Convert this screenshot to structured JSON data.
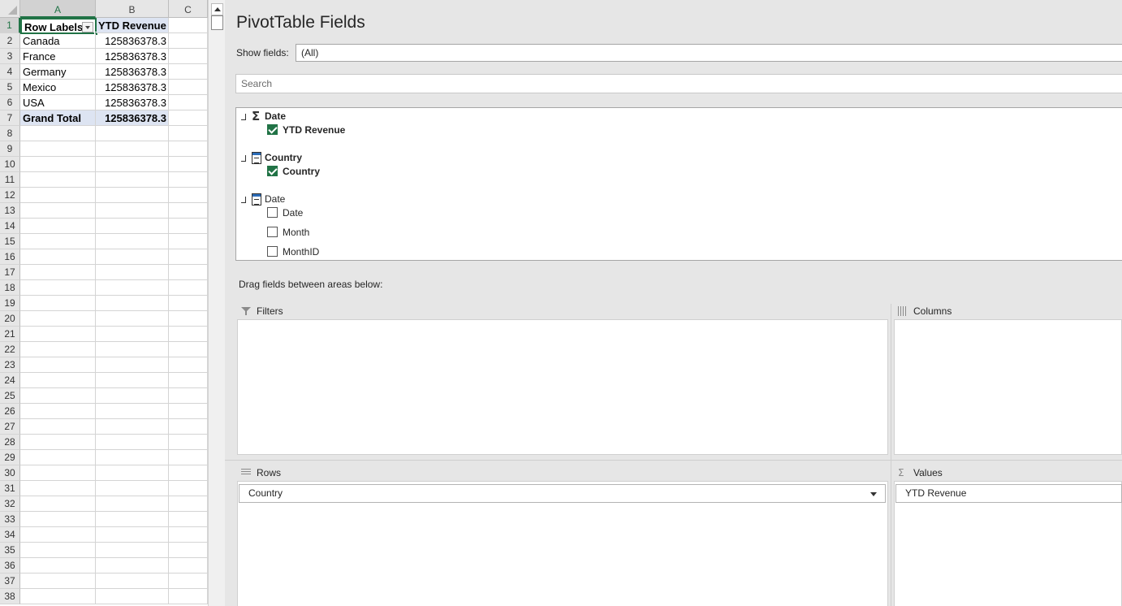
{
  "sheet": {
    "columns": [
      "A",
      "B",
      "C"
    ],
    "rows": [
      "1",
      "2",
      "3",
      "4",
      "5",
      "6",
      "7",
      "8",
      "9",
      "10",
      "11",
      "12",
      "13",
      "14",
      "15",
      "16",
      "17",
      "18",
      "19",
      "20",
      "21",
      "22",
      "23",
      "24",
      "25",
      "26",
      "27",
      "28",
      "29",
      "30",
      "31",
      "32",
      "33",
      "34",
      "35",
      "36",
      "37",
      "38"
    ],
    "pivot": {
      "header_a": "Row Labels",
      "header_b": "YTD Revenue",
      "items": [
        {
          "label": "Canada",
          "value": "125836378.3"
        },
        {
          "label": "France",
          "value": "125836378.3"
        },
        {
          "label": "Germany",
          "value": "125836378.3"
        },
        {
          "label": "Mexico",
          "value": "125836378.3"
        },
        {
          "label": "USA",
          "value": "125836378.3"
        }
      ],
      "total_label": "Grand Total",
      "total_value": "125836378.3"
    }
  },
  "pane": {
    "title": "PivotTable Fields",
    "show_fields_label": "Show fields:",
    "show_fields_value": "(All)",
    "search_placeholder": "Search",
    "tables": [
      {
        "name": "Date",
        "icon": "sigma-icon",
        "fields": [
          {
            "name": "YTD Revenue",
            "checked": true
          }
        ]
      },
      {
        "name": "Country",
        "icon": "table-icon",
        "fields": [
          {
            "name": "Country",
            "checked": true
          }
        ]
      },
      {
        "name": "Date",
        "icon": "table-icon",
        "fields": [
          {
            "name": "Date",
            "checked": false
          },
          {
            "name": "Month",
            "checked": false
          },
          {
            "name": "MonthID",
            "checked": false
          }
        ]
      }
    ],
    "drag_label": "Drag fields between areas below:",
    "areas": {
      "filters": {
        "title": "Filters"
      },
      "columns": {
        "title": "Columns"
      },
      "rows": {
        "title": "Rows",
        "item": "Country"
      },
      "values": {
        "title": "Values",
        "item": "YTD Revenue"
      }
    }
  },
  "colors": {
    "accent": "#217346",
    "highlight": "#dde4f2",
    "pane_bg": "#e6e6e6"
  }
}
